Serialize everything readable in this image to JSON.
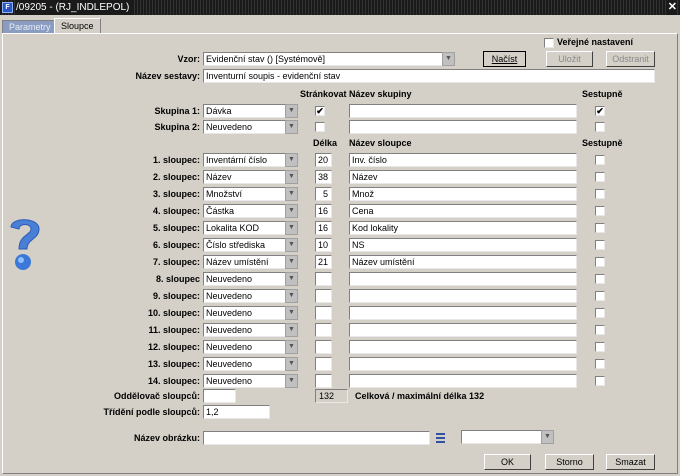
{
  "window": {
    "title": "/09205 - (RJ_INDLEPOL)",
    "close": "✕",
    "app_icon": "F"
  },
  "tabs": [
    {
      "label": "Parametry"
    },
    {
      "label": "Sloupce"
    }
  ],
  "top": {
    "vzor_label": "Vzor:",
    "vzor_value": "Evidenční stav  ()  [Systémově]",
    "nacist": "Načíst",
    "ulozit": "Uložit",
    "odstranit": "Odstranit",
    "verejne_label": "Veřejné nastavení",
    "nazev_sestavy_label": "Název sestavy:",
    "nazev_sestavy_value": "Inventurní soupis - evidenční stav"
  },
  "group_headers": {
    "strankovat": "Stránkovat",
    "nazev_skupiny": "Název skupiny",
    "sestupne": "Sestupně"
  },
  "groups": [
    {
      "label": "Skupina 1:",
      "value": "Dávka",
      "strankovat": "✔",
      "nazev": "",
      "sestupne": "✔"
    },
    {
      "label": "Skupina 2:",
      "value": "Neuvedeno",
      "strankovat": "",
      "nazev": "",
      "sestupne": ""
    }
  ],
  "column_headers": {
    "delka": "Délka",
    "nazev_sloupce": "Název sloupce",
    "sestupne": "Sestupně"
  },
  "columns": [
    {
      "label": "1. sloupec:",
      "value": "Inventární číslo",
      "delka": "20",
      "nazev": "Inv. číslo",
      "sestupne": ""
    },
    {
      "label": "2. sloupec:",
      "value": "Název",
      "delka": "38",
      "nazev": "Název",
      "sestupne": ""
    },
    {
      "label": "3. sloupec:",
      "value": "Množství",
      "delka": "5",
      "nazev": "Množ",
      "sestupne": ""
    },
    {
      "label": "4. sloupec:",
      "value": "Částka",
      "delka": "16",
      "nazev": "Cena",
      "sestupne": ""
    },
    {
      "label": "5. sloupec:",
      "value": "Lokalita KOD",
      "delka": "16",
      "nazev": "Kod lokality",
      "sestupne": ""
    },
    {
      "label": "6. sloupec:",
      "value": "Číslo střediska",
      "delka": "10",
      "nazev": "NS",
      "sestupne": ""
    },
    {
      "label": "7. sloupec:",
      "value": "Název umístění",
      "delka": "21",
      "nazev": "Název umístění",
      "sestupne": ""
    },
    {
      "label": "8. sloupec",
      "value": "Neuvedeno",
      "delka": "",
      "nazev": "",
      "sestupne": ""
    },
    {
      "label": "9. sloupec:",
      "value": "Neuvedeno",
      "delka": "",
      "nazev": "",
      "sestupne": ""
    },
    {
      "label": "10. sloupec:",
      "value": "Neuvedeno",
      "delka": "",
      "nazev": "",
      "sestupne": ""
    },
    {
      "label": "11. sloupec:",
      "value": "Neuvedeno",
      "delka": "",
      "nazev": "",
      "sestupne": ""
    },
    {
      "label": "12. sloupec:",
      "value": "Neuvedeno",
      "delka": "",
      "nazev": "",
      "sestupne": ""
    },
    {
      "label": "13. sloupec:",
      "value": "Neuvedeno",
      "delka": "",
      "nazev": "",
      "sestupne": ""
    },
    {
      "label": "14. sloupec:",
      "value": "Neuvedeno",
      "delka": "",
      "nazev": "",
      "sestupne": ""
    }
  ],
  "bottom": {
    "oddelovac_label": "Oddělovač sloupců:",
    "oddelovac_value": "",
    "total_value": "132",
    "total_text": "Celková / maximální délka 132",
    "trideni_label": "Třídění podle sloupců:",
    "trideni_value": "1,2",
    "obrazek_label": "Název obrázku:",
    "obrazek_value": "",
    "obrazek_select": ""
  },
  "buttons": {
    "ok": "OK",
    "storno": "Storno",
    "smazat": "Smazat"
  },
  "icons": {
    "help": "help-question-icon",
    "list": "list-icon"
  }
}
